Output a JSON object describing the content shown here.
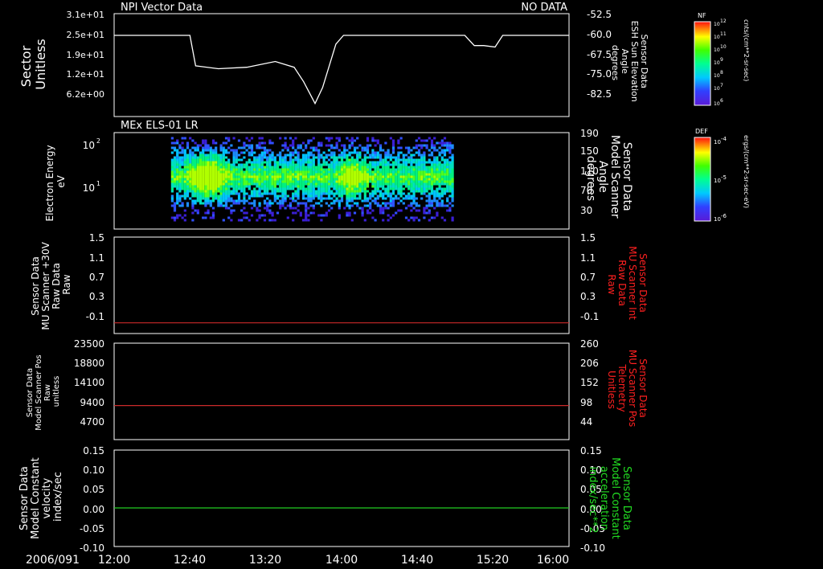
{
  "panel1": {
    "title": "NPI Vector Data",
    "status": "NO DATA",
    "left_label": [
      "Sector",
      "Unitless"
    ],
    "right_label": [
      "Sensor Data",
      "ESH Sun Elevation",
      "Angle",
      "degrees"
    ],
    "left_ticks": [
      "3.1e+01",
      "2.5e+01",
      "1.9e+01",
      "1.2e+01",
      "6.2e+00"
    ],
    "right_ticks": [
      "-52.5",
      "-60.0",
      "-67.5",
      "-75.0",
      "-82.5"
    ]
  },
  "panel2": {
    "title": "MEx ELS-01 LR",
    "left_label": [
      "Electron Energy",
      "eV"
    ],
    "right_label": [
      "Sensor Data",
      "Model Scanner",
      "Angle",
      "degrees"
    ],
    "left_ticks": [
      "10",
      "2",
      "10",
      "1"
    ],
    "right_ticks": [
      "190",
      "150",
      "110",
      "70",
      "30"
    ]
  },
  "panel3": {
    "left_label": [
      "Sensor Data",
      "MU Scanner +30V",
      "Raw Data",
      "Raw"
    ],
    "right_label": [
      "Sensor Data",
      "MU Scanner Int",
      "Raw Data",
      "Raw"
    ],
    "left_ticks": [
      "1.5",
      "1.1",
      "0.7",
      "0.3",
      "-0.1"
    ],
    "right_ticks": [
      "1.5",
      "1.1",
      "0.7",
      "0.3",
      "-0.1"
    ]
  },
  "panel4": {
    "left_label": [
      "Sensor Data",
      "Model Scanner Pos",
      "Raw",
      "unitless"
    ],
    "right_label": [
      "Sensor Data",
      "MU Scanner Pos",
      "Telemetry",
      "Unitless"
    ],
    "left_ticks": [
      "23500",
      "18800",
      "14100",
      "9400",
      "4700"
    ],
    "right_ticks": [
      "260",
      "206",
      "152",
      "98",
      "44"
    ]
  },
  "panel5": {
    "left_label": [
      "Sensor Data",
      "Model Constant",
      "velocity",
      "index/sec"
    ],
    "right_label": [
      "Sensor Data",
      "Model Constant",
      "acceleration",
      "index/sec**2"
    ],
    "left_ticks": [
      "0.15",
      "0.10",
      "0.05",
      "0.00",
      "-0.05",
      "-0.10"
    ],
    "right_ticks": [
      "0.15",
      "0.10",
      "0.05",
      "0.00",
      "-0.05",
      "-0.10"
    ]
  },
  "x_axis": {
    "date": "2006/091",
    "ticks": [
      "12:00",
      "12:40",
      "13:20",
      "14:00",
      "14:40",
      "15:20",
      "16:00"
    ]
  },
  "colorbars": {
    "nf": {
      "tag": "NF",
      "units": "cnts/(cm**2-sr-sec)",
      "ticks": [
        "10",
        "12",
        "10",
        "11",
        "10",
        "10",
        "10",
        "9",
        "10",
        "8",
        "10",
        "7",
        "10",
        "6"
      ]
    },
    "def": {
      "tag": "DEF",
      "units": "ergs/(cm**2-sr-sec-eV)",
      "ticks": [
        "10",
        "-4",
        "10",
        "-5",
        "10",
        "-6"
      ]
    }
  },
  "colors": {
    "axis": "#ffffff",
    "sun_elevation": "#ffffff",
    "red_trace": "#cc2a2a",
    "green_trace": "#22cc22",
    "red_label": "#ff2020",
    "green_label": "#22dd22"
  },
  "chart_data": [
    {
      "type": "line",
      "series": [
        {
          "name": "ESH Sun Elevation Angle",
          "x": [
            "12:00",
            "12:40",
            "12:43",
            "12:55",
            "13:10",
            "13:25",
            "13:35",
            "13:40",
            "13:46",
            "13:50",
            "13:57",
            "14:01",
            "14:20",
            "15:05",
            "15:10",
            "15:15",
            "15:21",
            "15:25",
            "16:00"
          ],
          "values": [
            -60.0,
            -60.0,
            -70.5,
            -71.5,
            -71.0,
            -69.0,
            -71.0,
            -76.0,
            -83.5,
            -78.0,
            -63.0,
            -60.0,
            -60.0,
            -60.0,
            -63.5,
            -63.5,
            -64.0,
            -60.0,
            -60.0
          ]
        }
      ],
      "ylim": [
        -88.0,
        -52.5
      ]
    },
    {
      "type": "heatmap",
      "x_range": [
        "12:30",
        "14:58"
      ],
      "y_range_eV": [
        4,
        120
      ],
      "hotspots": [
        "12:45",
        "12:53",
        "14:05"
      ]
    },
    {
      "type": "line",
      "series": [
        {
          "name": "MU Scanner +30V Raw",
          "x": [
            "12:00",
            "16:00"
          ],
          "values": [
            -0.1,
            -0.1
          ]
        }
      ],
      "ylim": [
        -0.3,
        1.5
      ]
    },
    {
      "type": "line",
      "series": [
        {
          "name": "Model Scanner Pos Raw",
          "x": [
            "12:00",
            "16:00"
          ],
          "values": [
            8300,
            8300
          ]
        }
      ],
      "ylim": [
        0,
        23500
      ]
    },
    {
      "type": "line",
      "series": [
        {
          "name": "Model Constant velocity",
          "x": [
            "12:00",
            "16:00"
          ],
          "values": [
            0.0,
            0.0
          ]
        }
      ],
      "ylim": [
        -0.1,
        0.15
      ]
    }
  ]
}
